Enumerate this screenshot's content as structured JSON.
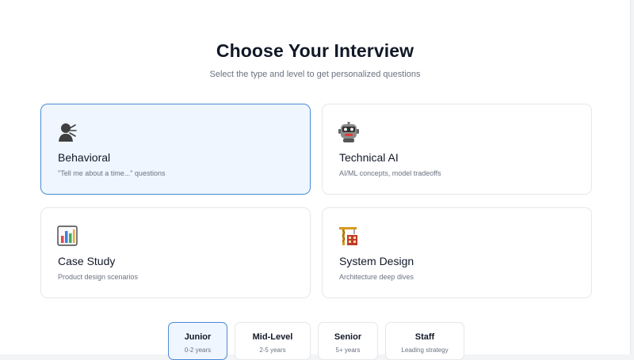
{
  "header": {
    "title": "Choose Your Interview",
    "subtitle": "Select the type and level to get personalized questions"
  },
  "interview_types": [
    {
      "icon": "person-speaking-icon",
      "name": "Behavioral",
      "desc": "\"Tell me about a time...\" questions",
      "selected": true
    },
    {
      "icon": "robot-icon",
      "name": "Technical AI",
      "desc": "AI/ML concepts, model tradeoffs",
      "selected": false
    },
    {
      "icon": "bar-chart-icon",
      "name": "Case Study",
      "desc": "Product design scenarios",
      "selected": false
    },
    {
      "icon": "construction-crane-icon",
      "name": "System Design",
      "desc": "Architecture deep dives",
      "selected": false
    }
  ],
  "levels": [
    {
      "name": "Junior",
      "sub": "0-2 years",
      "selected": true
    },
    {
      "name": "Mid-Level",
      "sub": "2-5 years",
      "selected": false
    },
    {
      "name": "Senior",
      "sub": "5+ years",
      "selected": false
    },
    {
      "name": "Staff",
      "sub": "Leading strategy",
      "selected": false
    }
  ],
  "colors": {
    "accent_border": "#4a8ad6",
    "selected_bg": "#eff6ff",
    "title_text": "#111827",
    "muted_text": "#6b7280"
  }
}
